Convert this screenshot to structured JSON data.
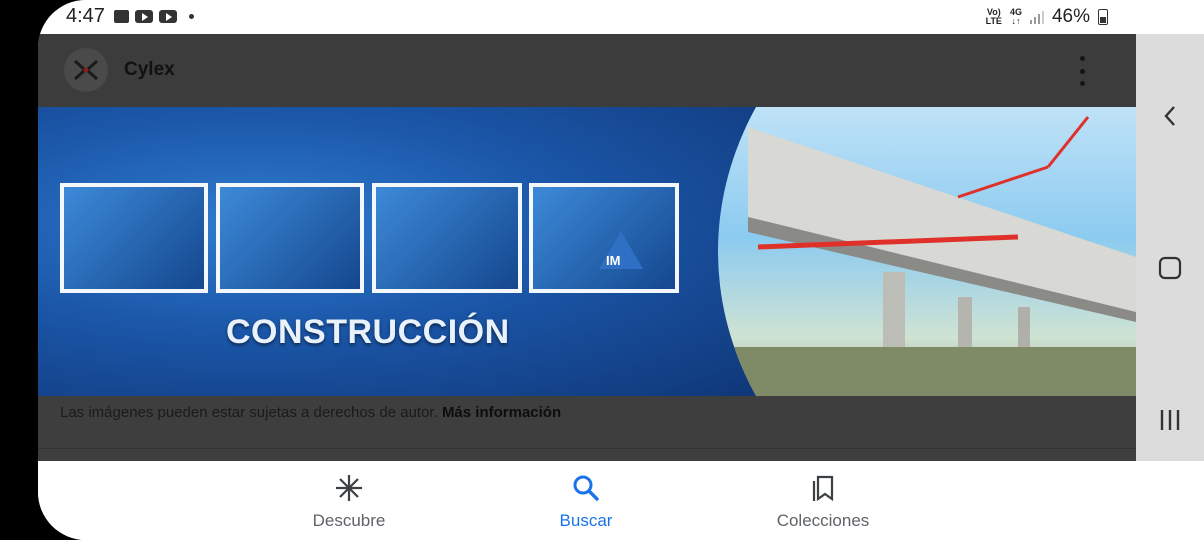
{
  "status_bar": {
    "time": "4:47",
    "battery": "46%",
    "volte_top": "Vo)",
    "volte_bottom": "LTE",
    "network_top": "4G"
  },
  "header": {
    "site_name": "Cylex"
  },
  "banner": {
    "title": "CONSTRUCCIÓN",
    "badge": "IM"
  },
  "disclaimer": {
    "text": "Las imágenes pueden estar sujetas a derechos de autor.",
    "link": "Más información"
  },
  "tabs": [
    {
      "label": "Descubre",
      "icon": "asterisk-icon",
      "active": false
    },
    {
      "label": "Buscar",
      "icon": "search-icon",
      "active": true
    },
    {
      "label": "Colecciones",
      "icon": "bookmarks-icon",
      "active": false
    }
  ],
  "colors": {
    "accent": "#1a73e8",
    "overlay": "#3e3e3e",
    "banner_blue": "#1b56a8"
  }
}
